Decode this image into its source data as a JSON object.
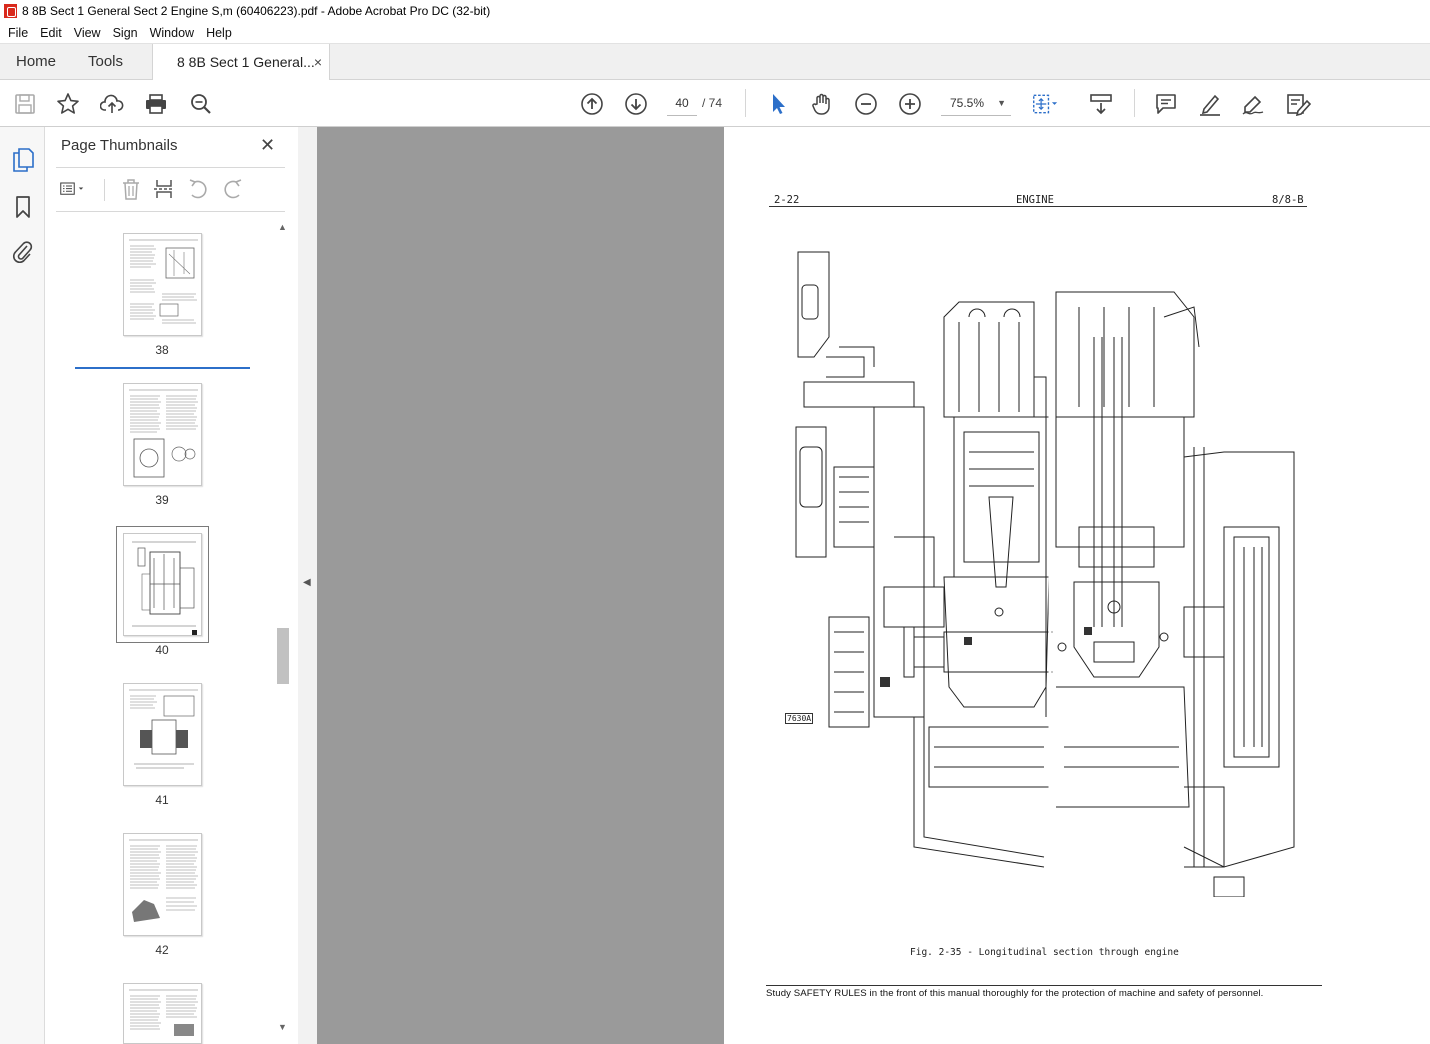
{
  "window": {
    "title": "8 8B Sect 1 General Sect 2 Engine S,m (60406223).pdf - Adobe Acrobat Pro DC (32-bit)"
  },
  "menu": [
    "File",
    "Edit",
    "View",
    "Sign",
    "Window",
    "Help"
  ],
  "tabs": {
    "home": "Home",
    "tools": "Tools",
    "document": "8 8B Sect 1 General...",
    "close": "×"
  },
  "toolbar": {
    "icons": [
      "save-icon",
      "star-icon",
      "upload-icon",
      "print-icon",
      "zoom-search-icon",
      "arrow-up-circle-icon",
      "arrow-down-circle-icon",
      "cursor-icon",
      "hand-icon",
      "zoom-out-icon",
      "zoom-in-icon",
      "fit-page-icon",
      "scroll-mode-icon",
      "comment-icon",
      "highlight-icon",
      "sign-icon",
      "edit-icon"
    ],
    "page_current": "40",
    "page_total": "/ 74",
    "zoom": "75.5%"
  },
  "thumbnails_panel": {
    "title": "Page Thumbnails",
    "close": "✕",
    "pages": [
      {
        "label": "38"
      },
      {
        "label": "39"
      },
      {
        "label": "40"
      },
      {
        "label": "41"
      },
      {
        "label": "42"
      }
    ],
    "selected_page": "40"
  },
  "document_page": {
    "header_left": "2-22",
    "header_center": "ENGINE",
    "header_right": "8/8-B",
    "figure_ref": "7630A",
    "caption": "Fig. 2-35 - Longitudinal section through engine",
    "footer": "Study SAFETY RULES in the front of this manual thoroughly for the protection of machine and safety of personnel."
  },
  "colors": {
    "accent": "#2c6fc9",
    "viewer_bg": "#9a9a9a",
    "acrobat_red": "#d9291c"
  }
}
